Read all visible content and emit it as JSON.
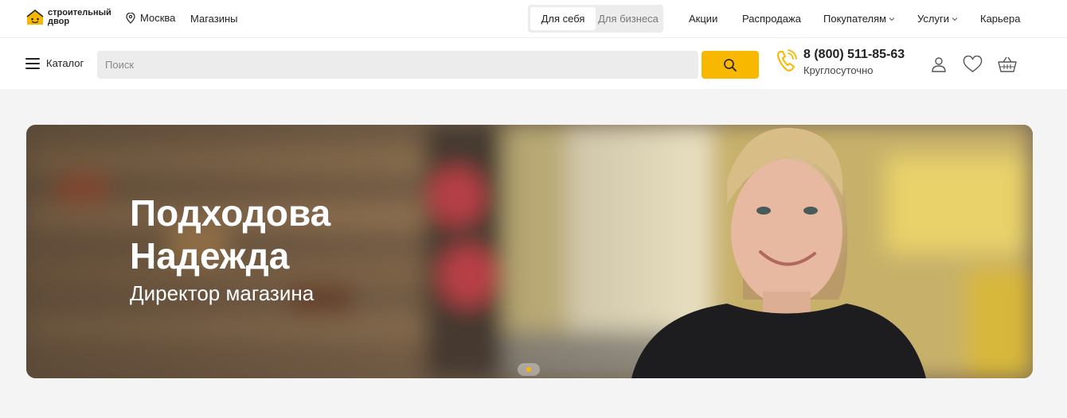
{
  "brand": {
    "logo_text": "строительный двор",
    "accent": "#f9b800"
  },
  "topbar": {
    "city": "Москва",
    "stores": "Магазины",
    "segments": [
      {
        "label": "Для себя",
        "active": true
      },
      {
        "label": "Для бизнеса",
        "active": false
      }
    ],
    "nav": [
      {
        "label": "Акции",
        "has_dropdown": false
      },
      {
        "label": "Распродажа",
        "has_dropdown": false
      },
      {
        "label": "Покупателям",
        "has_dropdown": true
      },
      {
        "label": "Услуги",
        "has_dropdown": true
      },
      {
        "label": "Карьера",
        "has_dropdown": false
      }
    ]
  },
  "header": {
    "catalog_label": "Каталог",
    "search_placeholder": "Поиск",
    "search_value": "",
    "phone_number": "8 (800) 511-85-63",
    "phone_hours": "Круглосуточно",
    "icons": [
      "user-icon",
      "heart-icon",
      "basket-icon"
    ]
  },
  "banner": {
    "name_line1": "Подходова",
    "name_line2": "Надежда",
    "role": "Директор магазина",
    "slides_total": 1,
    "active_slide": 1
  }
}
